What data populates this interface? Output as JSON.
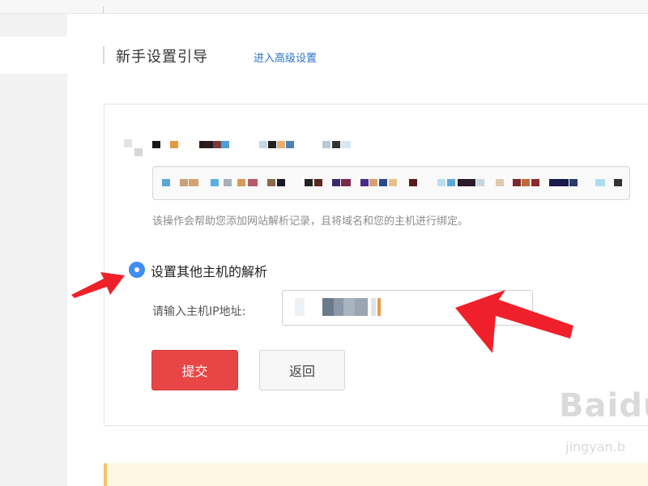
{
  "header": {
    "title": "新手设置引导",
    "advanced_link": "进入高级设置"
  },
  "form": {
    "hint": "该操作会帮助您添加网站解析记录，且将域名和您的主机进行绑定。",
    "option_label": "设置其他主机的解析",
    "ip_label": "请输入主机IP地址:",
    "ip_value": "23"
  },
  "buttons": {
    "submit": "提交",
    "back": "返回"
  },
  "watermark": {
    "brand": "Baidu",
    "sub": "jingyan.b"
  },
  "colors": {
    "accent": "#3f8ef0",
    "submit": "#e84646",
    "link": "#2a74c9",
    "arrow": "#f0202a"
  }
}
